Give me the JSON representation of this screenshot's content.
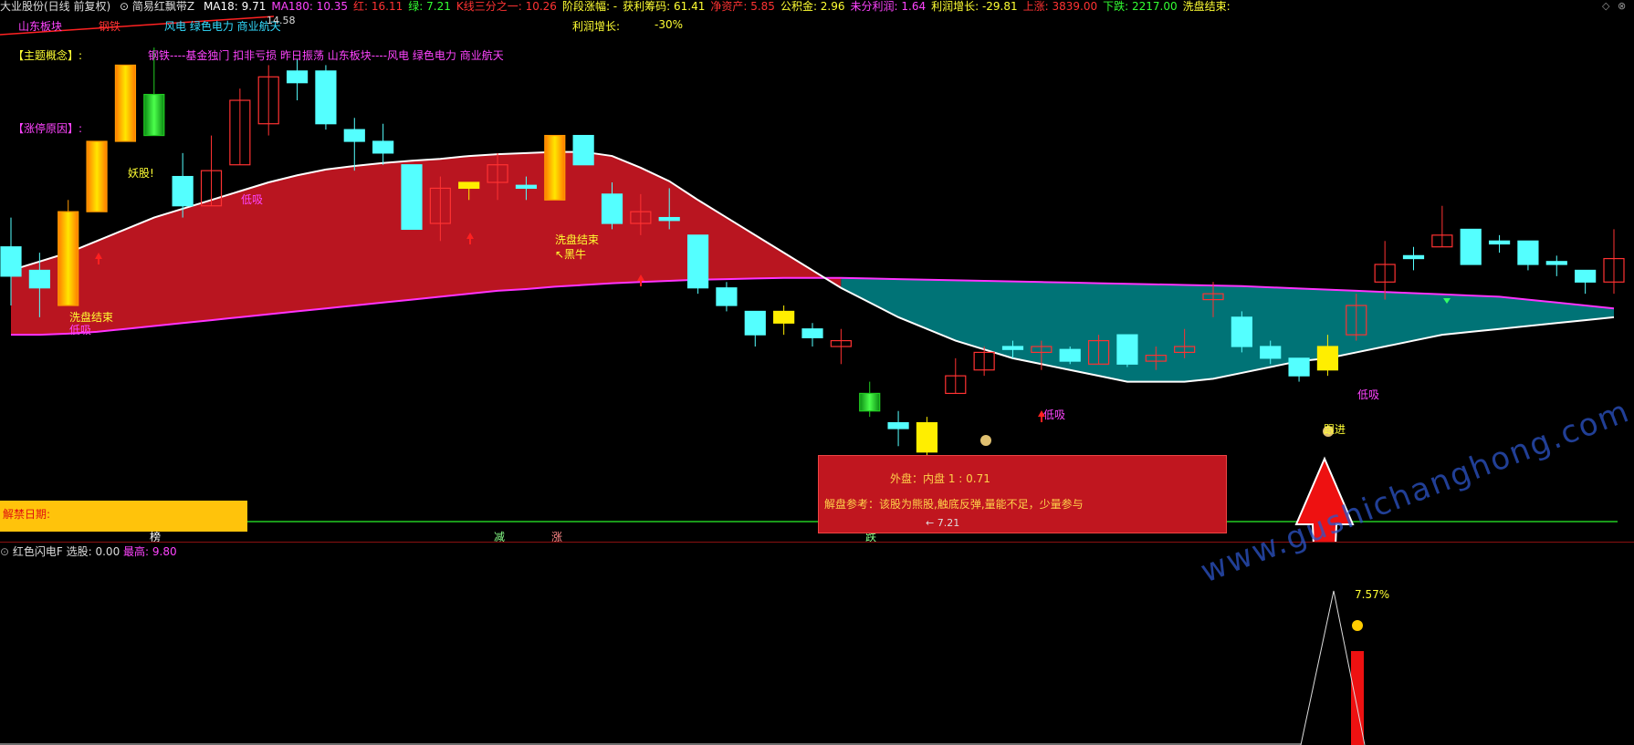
{
  "header": {
    "stock": "大业股份(日线 前复权)",
    "indicator": "简易红飘带Z",
    "items": [
      {
        "text": "MA18: 9.71",
        "color": "#ffffff"
      },
      {
        "text": "MA180: 10.35",
        "color": "#ff44ff"
      },
      {
        "text": "红: 16.11",
        "color": "#ff3333"
      },
      {
        "text": "绿: 7.21",
        "color": "#33ff33"
      },
      {
        "text": "K线三分之一: 10.26",
        "color": "#ff3333"
      },
      {
        "text": "阶段涨幅: -",
        "color": "#ffff33"
      },
      {
        "text": "获利筹码: 61.41",
        "color": "#ffff33"
      },
      {
        "text": "净资产: 5.85",
        "color": "#ff3333"
      },
      {
        "text": "公积金: 2.96",
        "color": "#ffff33"
      },
      {
        "text": "未分利润: 1.64",
        "color": "#ff44ff"
      },
      {
        "text": "利润增长: -29.81",
        "color": "#ffff33"
      },
      {
        "text": "上涨: 3839.00",
        "color": "#ff3333"
      },
      {
        "text": "下跌: 2217.00",
        "color": "#33ff33"
      },
      {
        "text": "洗盘结束:",
        "color": "#ffff33"
      }
    ]
  },
  "info": {
    "sector_label": "山东板块",
    "tag1": "钢铁",
    "concepts": "风电 绿色电力 商业航天",
    "price_top": "14.58",
    "profit_growth_label": "利润增长:",
    "profit_growth_value": "-30%",
    "theme_label": "【主题概念】:",
    "theme_text": "钢铁----基金独门 扣非亏损 昨日振荡 山东板块----风电 绿色电力 商业航天",
    "limit_reason_label": "【涨停原因】:",
    "unlock_label": "解禁日期:"
  },
  "popup": {
    "line1": "外盘：内盘 1 : 0.71",
    "line2": "解盘参考：该股为熊股,触底反弹,量能不足，少量参与"
  },
  "markers": {
    "wash_end": "洗盘结束",
    "low_suck": "低吸",
    "demon": "妖股!",
    "dark_horse": "↖黑牛",
    "follow": "跟进",
    "low_price": "← 7.21",
    "bottom_row": [
      {
        "text": "榜",
        "color": "#ffffff"
      },
      {
        "text": "减",
        "color": "#88ff88"
      },
      {
        "text": "涨",
        "color": "#ff8888"
      },
      {
        "text": "跌",
        "color": "#88ff88"
      }
    ]
  },
  "sub": {
    "name": "红色闪电F",
    "select_label": "选股: 0.00",
    "high_label": "最高: 9.80",
    "pct": "7.57%"
  },
  "watermark": "www.gushichanghong.com",
  "colors": {
    "up_hollow": "#ff3232",
    "down_fill": "#54ffff",
    "ribbon_red": "#b91520",
    "ribbon_teal": "#007376",
    "ma180": "#ff33ff",
    "ma18": "#ffffff",
    "zero_line": "#22cc22"
  },
  "chart_data": {
    "type": "candlestick",
    "title": "大业股份(日线 前复权)",
    "ma18_last": 9.71,
    "ma180_last": 10.35,
    "price_high_label": 14.58,
    "price_low_label": 7.21,
    "candles": [
      {
        "o": 11.5,
        "c": 11.0,
        "h": 12.0,
        "l": 10.5,
        "k": "down"
      },
      {
        "o": 11.1,
        "c": 10.8,
        "h": 11.4,
        "l": 10.3,
        "k": "down"
      },
      {
        "o": 10.5,
        "c": 12.1,
        "h": 12.3,
        "l": 10.5,
        "k": "gold"
      },
      {
        "o": 12.1,
        "c": 13.3,
        "h": 13.3,
        "l": 12.1,
        "k": "gold"
      },
      {
        "o": 13.3,
        "c": 14.6,
        "h": 14.6,
        "l": 13.3,
        "k": "gold"
      },
      {
        "o": 14.1,
        "c": 13.4,
        "h": 14.9,
        "l": 13.4,
        "k": "green"
      },
      {
        "o": 12.7,
        "c": 12.2,
        "h": 13.1,
        "l": 12.0,
        "k": "down"
      },
      {
        "o": 12.2,
        "c": 12.8,
        "h": 13.4,
        "l": 12.2,
        "k": "up"
      },
      {
        "o": 12.9,
        "c": 14.0,
        "h": 14.2,
        "l": 12.9,
        "k": "up"
      },
      {
        "o": 13.6,
        "c": 14.4,
        "h": 14.6,
        "l": 13.4,
        "k": "up"
      },
      {
        "o": 14.5,
        "c": 14.3,
        "h": 14.7,
        "l": 14.0,
        "k": "down"
      },
      {
        "o": 14.5,
        "c": 13.6,
        "h": 14.6,
        "l": 13.5,
        "k": "down"
      },
      {
        "o": 13.5,
        "c": 13.3,
        "h": 13.7,
        "l": 12.8,
        "k": "down"
      },
      {
        "o": 13.3,
        "c": 13.1,
        "h": 13.6,
        "l": 12.9,
        "k": "down"
      },
      {
        "o": 12.9,
        "c": 11.8,
        "h": 12.9,
        "l": 11.8,
        "k": "down"
      },
      {
        "o": 11.9,
        "c": 12.5,
        "h": 12.7,
        "l": 11.6,
        "k": "up"
      },
      {
        "o": 12.5,
        "c": 12.6,
        "h": 12.6,
        "l": 12.3,
        "k": "yellow"
      },
      {
        "o": 12.6,
        "c": 12.9,
        "h": 13.1,
        "l": 12.3,
        "k": "up"
      },
      {
        "o": 12.55,
        "c": 12.5,
        "h": 12.7,
        "l": 12.3,
        "k": "down"
      },
      {
        "o": 12.3,
        "c": 13.4,
        "h": 13.4,
        "l": 12.3,
        "k": "gold"
      },
      {
        "o": 13.4,
        "c": 12.9,
        "h": 13.4,
        "l": 12.9,
        "k": "down"
      },
      {
        "o": 12.4,
        "c": 11.9,
        "h": 12.6,
        "l": 11.8,
        "k": "down"
      },
      {
        "o": 11.9,
        "c": 12.1,
        "h": 12.4,
        "l": 11.7,
        "k": "up"
      },
      {
        "o": 12.0,
        "c": 11.95,
        "h": 12.5,
        "l": 11.8,
        "k": "down"
      },
      {
        "o": 11.7,
        "c": 10.8,
        "h": 11.7,
        "l": 10.7,
        "k": "down"
      },
      {
        "o": 10.8,
        "c": 10.5,
        "h": 10.9,
        "l": 10.4,
        "k": "down"
      },
      {
        "o": 10.4,
        "c": 10.0,
        "h": 10.4,
        "l": 9.8,
        "k": "down"
      },
      {
        "o": 10.2,
        "c": 10.4,
        "h": 10.5,
        "l": 10.0,
        "k": "yellow"
      },
      {
        "o": 10.1,
        "c": 9.95,
        "h": 10.2,
        "l": 9.8,
        "k": "down"
      },
      {
        "o": 9.8,
        "c": 9.9,
        "h": 10.1,
        "l": 9.5,
        "k": "up"
      },
      {
        "o": 9.0,
        "c": 8.7,
        "h": 9.2,
        "l": 8.6,
        "k": "green"
      },
      {
        "o": 8.4,
        "c": 8.5,
        "h": 8.7,
        "l": 8.1,
        "k": "down"
      },
      {
        "o": 8.5,
        "c": 8.0,
        "h": 8.6,
        "l": 7.21,
        "k": "yellow"
      },
      {
        "o": 9.0,
        "c": 9.3,
        "h": 9.6,
        "l": 9.0,
        "k": "up"
      },
      {
        "o": 9.4,
        "c": 9.7,
        "h": 9.8,
        "l": 9.3,
        "k": "up"
      },
      {
        "o": 9.8,
        "c": 9.75,
        "h": 9.9,
        "l": 9.6,
        "k": "down"
      },
      {
        "o": 9.7,
        "c": 9.8,
        "h": 9.9,
        "l": 9.4,
        "k": "up"
      },
      {
        "o": 9.75,
        "c": 9.55,
        "h": 9.8,
        "l": 9.5,
        "k": "down"
      },
      {
        "o": 9.5,
        "c": 9.9,
        "h": 10.0,
        "l": 9.5,
        "k": "up"
      },
      {
        "o": 10.0,
        "c": 9.5,
        "h": 10.0,
        "l": 9.45,
        "k": "down"
      },
      {
        "o": 9.55,
        "c": 9.65,
        "h": 9.8,
        "l": 9.4,
        "k": "up"
      },
      {
        "o": 9.7,
        "c": 9.8,
        "h": 10.1,
        "l": 9.6,
        "k": "up"
      },
      {
        "o": 10.6,
        "c": 10.7,
        "h": 10.9,
        "l": 10.3,
        "k": "up"
      },
      {
        "o": 10.3,
        "c": 9.8,
        "h": 10.4,
        "l": 9.7,
        "k": "down"
      },
      {
        "o": 9.8,
        "c": 9.6,
        "h": 9.9,
        "l": 9.5,
        "k": "down"
      },
      {
        "o": 9.6,
        "c": 9.3,
        "h": 9.6,
        "l": 9.2,
        "k": "down"
      },
      {
        "o": 9.4,
        "c": 9.8,
        "h": 10.0,
        "l": 9.3,
        "k": "yellow"
      },
      {
        "o": 10.0,
        "c": 10.5,
        "h": 10.7,
        "l": 9.9,
        "k": "up"
      },
      {
        "o": 10.9,
        "c": 11.2,
        "h": 11.6,
        "l": 10.6,
        "k": "up"
      },
      {
        "o": 11.35,
        "c": 11.3,
        "h": 11.5,
        "l": 11.1,
        "k": "down"
      },
      {
        "o": 11.5,
        "c": 11.7,
        "h": 12.2,
        "l": 11.5,
        "k": "up"
      },
      {
        "o": 11.8,
        "c": 11.2,
        "h": 11.8,
        "l": 11.2,
        "k": "down"
      },
      {
        "o": 11.6,
        "c": 11.55,
        "h": 11.7,
        "l": 11.4,
        "k": "down"
      },
      {
        "o": 11.6,
        "c": 11.2,
        "h": 11.6,
        "l": 11.1,
        "k": "down"
      },
      {
        "o": 11.25,
        "c": 11.2,
        "h": 11.35,
        "l": 11.0,
        "k": "down"
      },
      {
        "o": 11.1,
        "c": 10.9,
        "h": 11.1,
        "l": 10.7,
        "k": "down"
      },
      {
        "o": 10.9,
        "c": 11.3,
        "h": 11.8,
        "l": 10.7,
        "k": "up"
      }
    ],
    "ma18": [
      11.1,
      11.25,
      11.4,
      11.6,
      11.8,
      12.0,
      12.15,
      12.3,
      12.45,
      12.6,
      12.72,
      12.82,
      12.88,
      12.93,
      12.97,
      13.0,
      13.05,
      13.08,
      13.1,
      13.12,
      13.12,
      13.05,
      12.85,
      12.62,
      12.3,
      12.0,
      11.7,
      11.4,
      11.1,
      10.8,
      10.55,
      10.3,
      10.1,
      9.9,
      9.75,
      9.6,
      9.5,
      9.4,
      9.3,
      9.2,
      9.2,
      9.2,
      9.25,
      9.35,
      9.45,
      9.55,
      9.6,
      9.7,
      9.8,
      9.9,
      10.0,
      10.05,
      10.1,
      10.15,
      10.2,
      10.25,
      10.3
    ],
    "ma180": [
      10.0,
      10.0,
      10.02,
      10.05,
      10.1,
      10.15,
      10.2,
      10.25,
      10.3,
      10.35,
      10.4,
      10.45,
      10.5,
      10.55,
      10.6,
      10.65,
      10.7,
      10.75,
      10.78,
      10.82,
      10.85,
      10.88,
      10.9,
      10.92,
      10.94,
      10.95,
      10.96,
      10.97,
      10.97,
      10.97,
      10.96,
      10.95,
      10.94,
      10.93,
      10.92,
      10.91,
      10.9,
      10.89,
      10.88,
      10.87,
      10.86,
      10.85,
      10.84,
      10.83,
      10.81,
      10.79,
      10.77,
      10.75,
      10.73,
      10.71,
      10.69,
      10.67,
      10.65,
      10.6,
      10.55,
      10.5,
      10.45
    ],
    "sub_bar_value": 9.8,
    "sub_percent": 7.57
  }
}
